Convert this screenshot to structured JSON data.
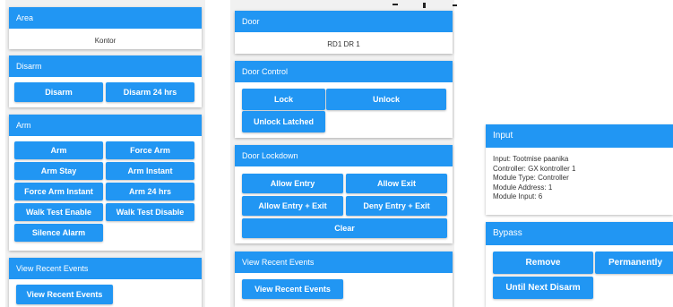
{
  "col1": {
    "area": {
      "title": "Area",
      "value": "Kontor"
    },
    "disarm": {
      "title": "Disarm",
      "buttons": [
        "Disarm",
        "Disarm 24 hrs"
      ]
    },
    "arm": {
      "title": "Arm",
      "buttons": [
        "Arm",
        "Force Arm",
        "Arm Stay",
        "Arm Instant",
        "Force Arm Instant",
        "Arm 24 hrs",
        "Walk Test Enable",
        "Walk Test Disable",
        "Silence Alarm"
      ]
    },
    "recent": {
      "title": "View Recent Events",
      "button": "View Recent Events"
    }
  },
  "col2": {
    "door": {
      "title": "Door",
      "value": "RD1 DR 1"
    },
    "door_control": {
      "title": "Door Control",
      "buttons": [
        "Lock",
        "Unlock",
        "Unlock Latched"
      ]
    },
    "door_lockdown": {
      "title": "Door Lockdown",
      "buttons": [
        "Allow Entry",
        "Allow Exit",
        "Allow Entry + Exit",
        "Deny Entry + Exit",
        "Clear"
      ]
    },
    "recent": {
      "title": "View Recent Events",
      "button": "View Recent Events"
    }
  },
  "col3": {
    "input": {
      "title": "Input",
      "lines": [
        "Input: Tootmise paanika",
        "Controller: GX kontroller 1",
        "Module Type: Controller",
        "Module Address: 1",
        "Module Input: 6"
      ]
    },
    "bypass": {
      "title": "Bypass",
      "buttons": [
        "Remove",
        "Permanently",
        "Until Next Disarm"
      ]
    }
  },
  "colors": {
    "accent": "#2196f3",
    "panel_bg": "#f1f1f1",
    "text": "#333333"
  }
}
